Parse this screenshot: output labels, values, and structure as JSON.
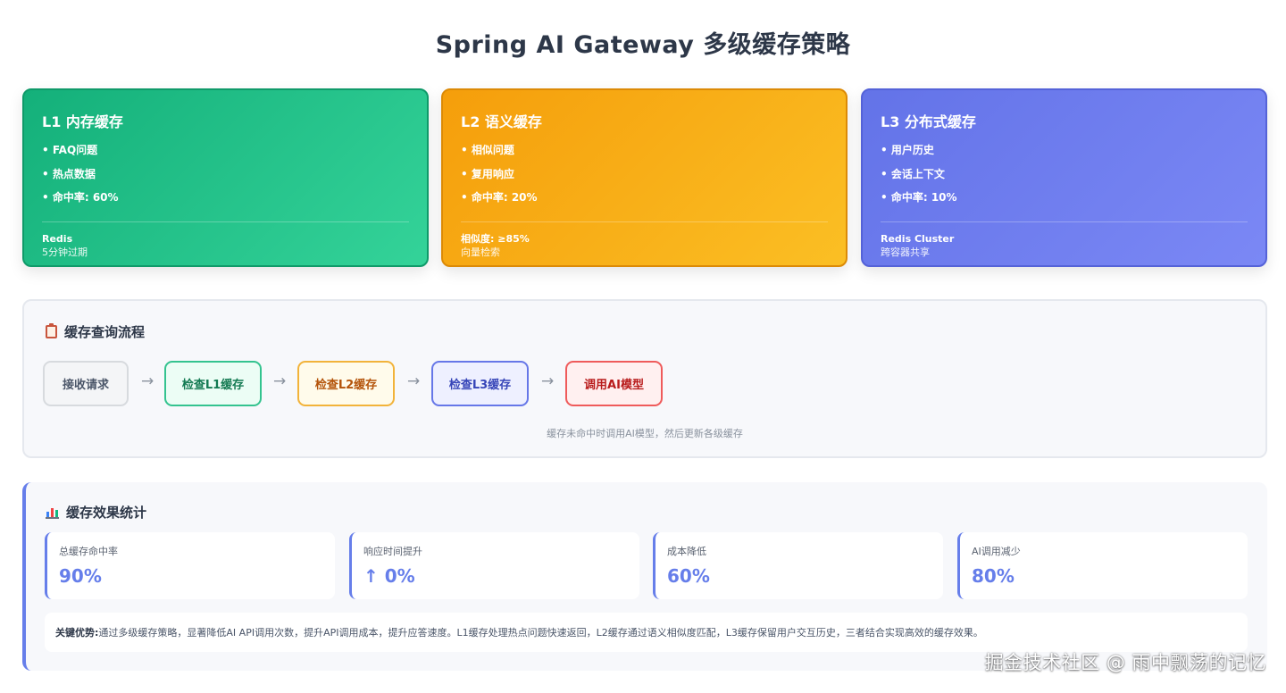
{
  "page": {
    "title": "Spring AI Gateway 多级缓存策略"
  },
  "tiers": [
    {
      "title": "L1 内存缓存",
      "items": [
        "• FAQ问题",
        "• 热点数据",
        "• 命中率: 60%"
      ],
      "meta_primary": "Redis",
      "meta_secondary": "5分钟过期",
      "color": "#10b981"
    },
    {
      "title": "L2 语义缓存",
      "items": [
        "• 相似问题",
        "• 复用响应",
        "• 命中率: 20%"
      ],
      "meta_primary": "相似度: ≥85%",
      "meta_secondary": "向量检索",
      "color": "#f59e0b"
    },
    {
      "title": "L3 分布式缓存",
      "items": [
        "• 用户历史",
        "• 会话上下文",
        "• 命中率: 10%"
      ],
      "meta_primary": "Redis Cluster",
      "meta_secondary": "跨容器共享",
      "color": "#667eea"
    }
  ],
  "flow": {
    "icon": "clipboard-icon",
    "title": "缓存查询流程",
    "steps": [
      "接收请求",
      "检查L1缓存",
      "检查L2缓存",
      "检查L3缓存",
      "调用AI模型"
    ],
    "arrow": "→",
    "note": "缓存未命中时调用AI模型，然后更新各级缓存"
  },
  "stats": {
    "icon": "bar-chart-icon",
    "title": "缓存效果统计",
    "cards": [
      {
        "label": "总缓存命中率",
        "value": "90%"
      },
      {
        "label": "响应时间提升",
        "value": "↑ 0%"
      },
      {
        "label": "成本降低",
        "value": "60%"
      },
      {
        "label": "AI调用减少",
        "value": "80%"
      }
    ],
    "note_label": "关键优势:",
    "note_text": "通过多级缓存策略，显著降低AI API调用次数，提升API调用成本，提升应答速度。L1缓存处理热点问题快速返回，L2缓存通过语义相似度匹配，L3缓存保留用户交互历史，三者结合实现高效的缓存效果。",
    "accent_color": "#667eea"
  },
  "watermark": "掘金技术社区 @ 雨中飘荡的记忆"
}
